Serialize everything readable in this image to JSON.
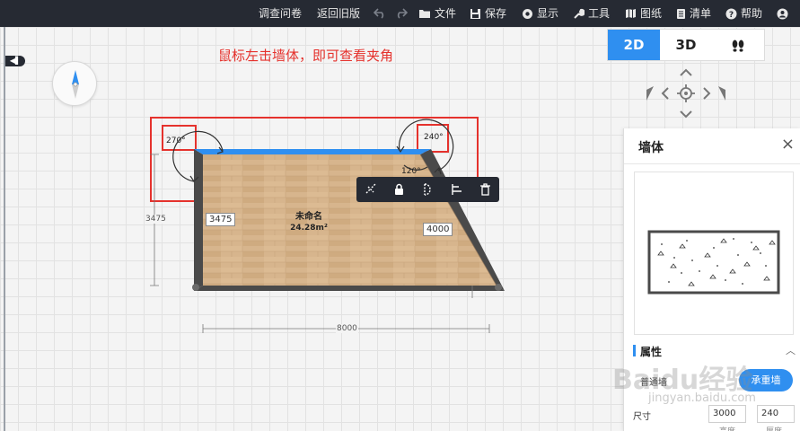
{
  "toolbar": {
    "survey": "调查问卷",
    "old_version": "返回旧版",
    "file": "文件",
    "save": "保存",
    "display": "显示",
    "tools": "工具",
    "drawing": "图纸",
    "list": "清单",
    "help": "帮助"
  },
  "view_modes": [
    "2D",
    "3D",
    ""
  ],
  "annotation": "鼠标左击墙体，即可查看夹角",
  "plan": {
    "room_name": "未命名",
    "room_area": "24.28m²",
    "angle_left": "270°",
    "angle_right": "240°",
    "angle_inner": "120°",
    "wall_left_length": "3475",
    "wall_right_length": "4000",
    "dim_height": "3475",
    "dim_width": "8000"
  },
  "panel": {
    "title": "墙体",
    "close": "×",
    "attributes_title": "属性",
    "material_label": "普通墙",
    "bearing_button": "承重墙",
    "size_label": "尺寸",
    "height_value": "3000",
    "thickness_value": "240",
    "height_caption": "高度",
    "thickness_caption": "厚度"
  },
  "watermark": "Baidu经验",
  "watermark_url": "jingyan.baidu.com",
  "colors": {
    "topbar": "#262a33",
    "accent": "#2f8ff0",
    "annotation": "#e5322d",
    "wall": "#4a4a4a",
    "selected_wall": "#2f8ff0"
  }
}
